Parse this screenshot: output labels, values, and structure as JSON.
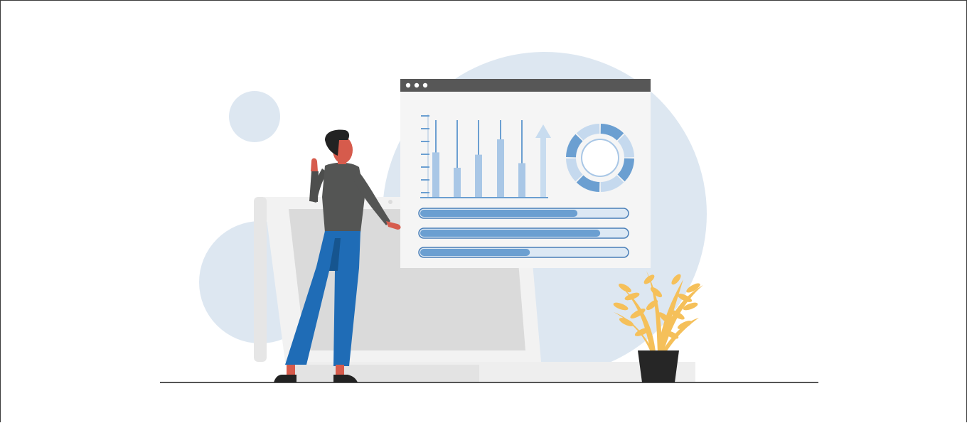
{
  "illustration": {
    "subject": "analytics-dashboard-illustration",
    "colors": {
      "background": "#ffffff",
      "bubble": "#dde7f1",
      "monitor_frame": "#f2f2f2",
      "monitor_screen": "#dadada",
      "window_titlebar": "#575757",
      "window_body": "#f5f5f5",
      "chart_accent": "#6b9fd1",
      "chart_light": "#a9c7e6",
      "chart_border": "#4a7fb8",
      "person_shirt": "#545554",
      "person_pants": "#1f6cb6",
      "person_skin": "#d65b4c",
      "person_hair": "#222222",
      "plant_leaves": "#f5c05a",
      "plant_pot": "#262626",
      "floor_line": "#555555"
    },
    "dashboard": {
      "window_controls": [
        "dot-icon",
        "dot-icon",
        "dot-icon"
      ],
      "bar_levels": [
        0.58,
        0.38,
        0.55,
        0.75,
        0.44
      ],
      "progress_levels": [
        0.76,
        0.87,
        0.53
      ],
      "donut_segments": 8
    }
  }
}
